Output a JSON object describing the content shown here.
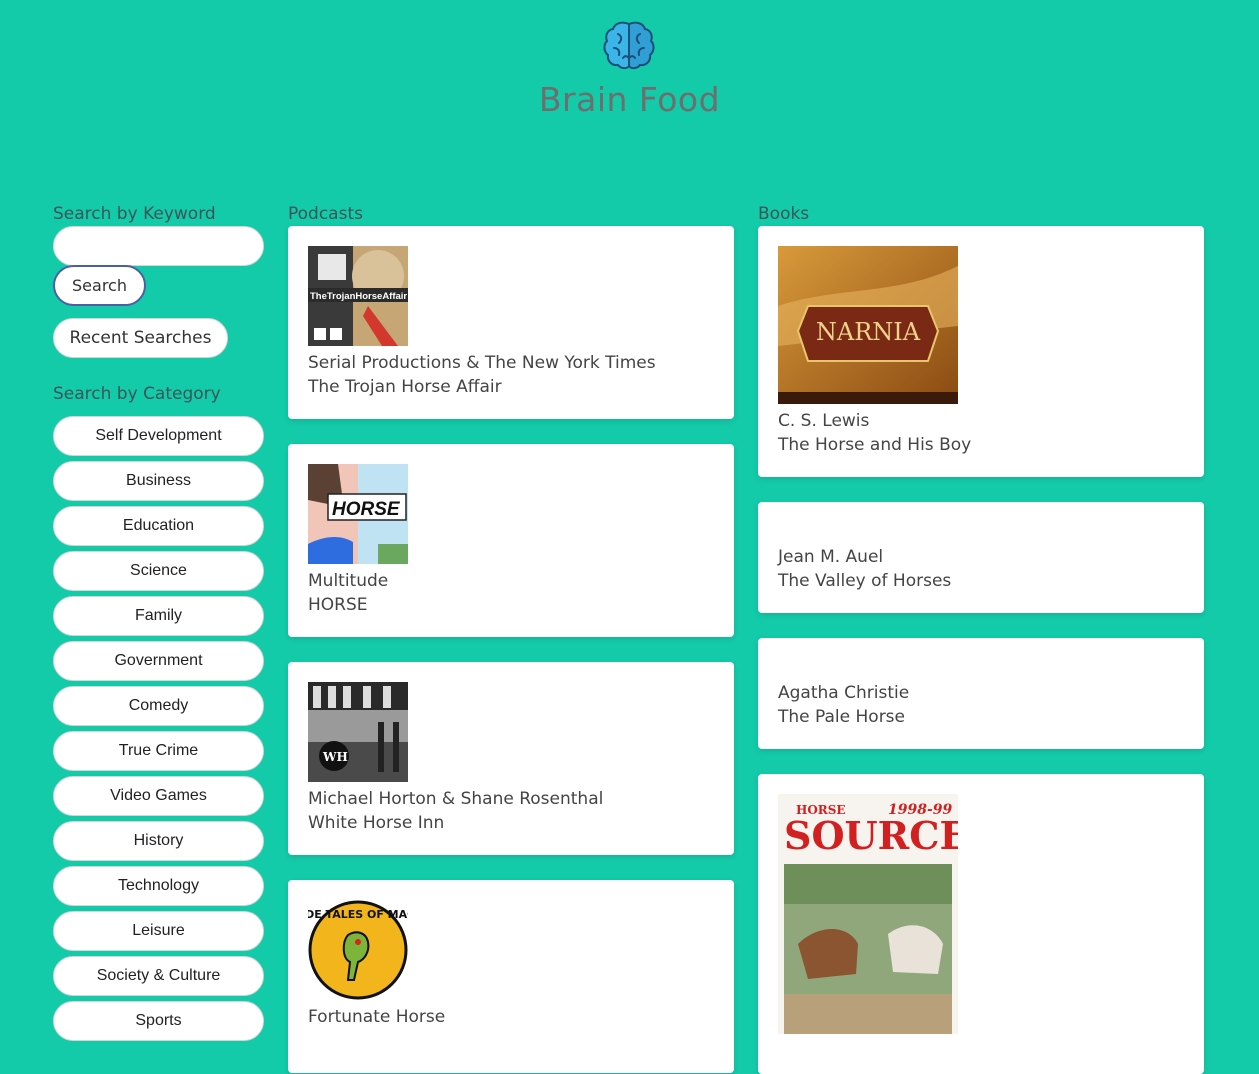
{
  "site": {
    "title": "Brain Food",
    "logo_icon": "brain-icon"
  },
  "search": {
    "keyword_label": "Search by Keyword",
    "input_value": "",
    "search_button": "Search",
    "recent_button": "Recent Searches"
  },
  "categories": {
    "label": "Search by Category",
    "items": [
      "Self Development",
      "Business",
      "Education",
      "Science",
      "Family",
      "Government",
      "Comedy",
      "True Crime",
      "Video Games",
      "History",
      "Technology",
      "Leisure",
      "Society & Culture",
      "Sports"
    ]
  },
  "podcasts": {
    "label": "Podcasts",
    "items": [
      {
        "author": "Serial Productions & The New York Times",
        "title": "The Trojan Horse Affair",
        "cover_text": "TheTrojanHorseAffair"
      },
      {
        "author": "Multitude",
        "title": "HORSE",
        "cover_text": "HORSE"
      },
      {
        "author": "Michael Horton & Shane Rosenthal",
        "title": "White Horse Inn",
        "cover_text": "WH"
      },
      {
        "author": "Fortunate Horse",
        "title": "",
        "cover_text": "RUDE TALES OF MAGIC"
      }
    ]
  },
  "books": {
    "label": "Books",
    "items": [
      {
        "author": "C. S. Lewis",
        "title": "The Horse and His Boy",
        "cover_text": "NARNIA"
      },
      {
        "author": "Jean M. Auel",
        "title": "The Valley of Horses"
      },
      {
        "author": "Agatha Christie",
        "title": "The Pale Horse"
      },
      {
        "author": "",
        "title": "",
        "cover_text": "SOURCE",
        "cover_subtext": "HORSE",
        "cover_year": "1998-99"
      }
    ]
  },
  "colors": {
    "background": "#13cba9",
    "button_border_active": "#4a5fa6"
  }
}
